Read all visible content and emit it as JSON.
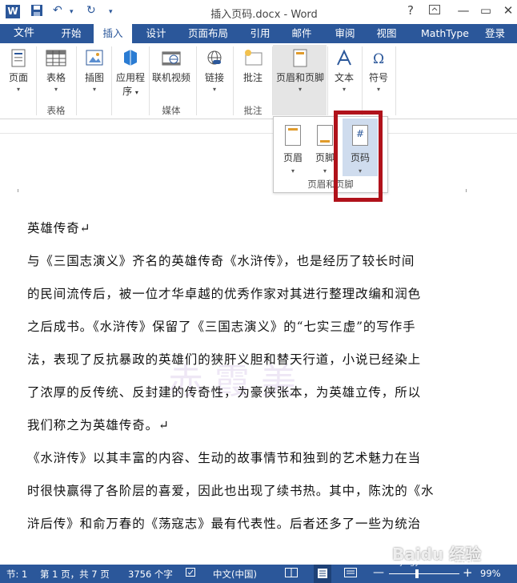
{
  "titlebar": {
    "title": "插入页码.docx - Word",
    "app_icon": "W",
    "help": "?",
    "minimize": "—",
    "restore": "▭",
    "close": "✕"
  },
  "qat": {
    "save": "save-icon",
    "undo": "↶",
    "undo_dd": "▾",
    "redo": "↻",
    "customize": "▾"
  },
  "tabs": [
    "文件",
    "开始",
    "插入",
    "设计",
    "页面布局",
    "引用",
    "邮件",
    "审阅",
    "视图",
    "MathType",
    "登录"
  ],
  "active_tab": "插入",
  "ribbon": {
    "pages": "页面",
    "table": "表格",
    "illustrations": "插图",
    "apps_line1": "应用程",
    "apps_line2": "序",
    "online_video": "联机视频",
    "links": "链接",
    "comment": "批注",
    "header_footer": "页眉和页脚",
    "text": "文本",
    "symbols": "符号",
    "group_table": "表格",
    "group_media": "媒体",
    "group_comment": "批注"
  },
  "popup": {
    "header": "页眉",
    "footer": "页脚",
    "page_number": "页码",
    "page_number_glyph": "#",
    "group_label": "页眉和页脚"
  },
  "document": {
    "lines": [
      "英雄传奇↵",
      "与《三国志演义》齐名的英雄传奇《水浒传》，也是经历了较长时间",
      "的民间流传后，被一位才华卓越的优秀作家对其进行整理改编和润色",
      "之后成书。《水浒传》保留了《三国志演义》的“七实三虚”的写作手",
      "法，表现了反抗暴政的英雄们的狭肝义胆和替天行道，小说已经染上",
      "了浓厚的反传统、反封建的传奇性，为豪侠张本，为英雄立传，所以",
      "我们称之为英雄传奇。↵",
      "《水浒传》以其丰富的内容、生动的故事情节和独到的艺术魅力在当",
      "时很快赢得了各阶层的喜爱，因此也出现了续书热。其中，陈沈的《水",
      "浒后传》和俞万春的《荡寇志》最有代表性。后者还多了一些为统治"
    ],
    "watermark": "赤霞美"
  },
  "statusbar": {
    "section": "节: 1",
    "page": "第 1 页，共 7 页",
    "words": "3756 个字",
    "language": "中文(中国)",
    "zoom": "99%",
    "zoom_out": "—",
    "zoom_in": "+"
  },
  "overlay": {
    "baidu": "Baidu 经验",
    "url": "jingyan.baidu.com"
  },
  "colors": {
    "accent": "#2b579a",
    "highlight": "#b0121b"
  }
}
